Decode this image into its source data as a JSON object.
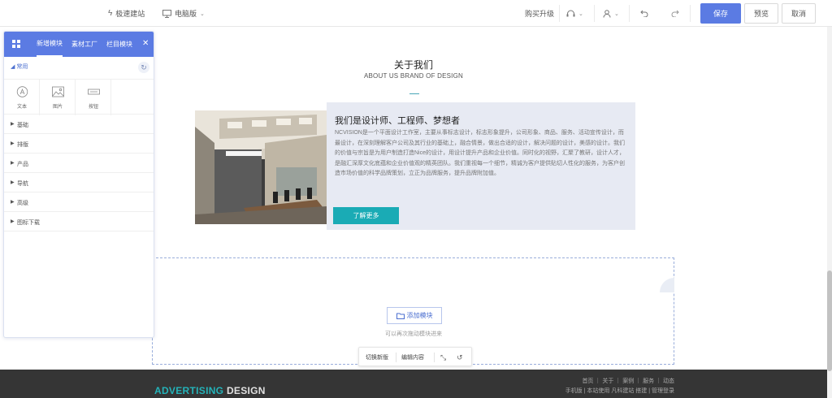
{
  "toolbar": {
    "quick_build": "极速建站",
    "device": "电脑版",
    "upgrade": "购买升级",
    "save": "保存",
    "preview": "预览",
    "cancel": "取消"
  },
  "panel": {
    "tabs": [
      "新增模块",
      "素材工厂",
      "栏目模块"
    ],
    "active_tab": "新增模块",
    "category": "常用",
    "widgets": [
      {
        "label": "文本",
        "icon": "text-icon"
      },
      {
        "label": "图片",
        "icon": "image-icon"
      },
      {
        "label": "按钮",
        "icon": "button-icon"
      }
    ],
    "categories": [
      "基础",
      "排版",
      "产品",
      "导航",
      "高级",
      "图标下载"
    ]
  },
  "page": {
    "about_title": "关于我们",
    "about_subtitle": "ABOUT US BRAND OF DESIGN",
    "card_title": "我们是设计师、工程师、梦想者",
    "card_body": "NCVISION是一个平面设计工作室，主要从事标志设计，标志形象提升，公司形象、商品、服务、活动宣传设计，而最设计，在深刻理解客户公司及其行业的基础上，融合情景，做出合适的设计，解决问题的设计，美感的设计。我们的价值与宗旨是为用户制造打造Nice的设计，用设计提升产品和企业价值。同时化的视野，汇聚了教研，设计人才，是融汇深厚文化底蕴和企业价值观的精英团队。我们重视每一个细节，精诚为客户提供贴切人性化的服务，为客户创造市场价值的科学品牌策划，立正为品牌服务，提升品牌附加值。",
    "card_button": "了解更多",
    "add_block": "添加模块",
    "add_tip": "可以再次拖动模块进来",
    "float_bar": [
      "切换新版",
      "编辑内容"
    ],
    "footer_brand_a": "ADVERTISING",
    "footer_brand_b": "DESIGN",
    "footer_nav": "首页 ｜ 关于 ｜ 案例 ｜ 服务 ｜ 动态",
    "footer_nav2": "手机版 | 本站使用 凡科建站 搭建 | 管理登录"
  },
  "colors": {
    "primary": "#5b7be3",
    "accent_teal": "#1aabb5",
    "card_bg": "#e7eaf3",
    "footer_bg": "#353535"
  }
}
